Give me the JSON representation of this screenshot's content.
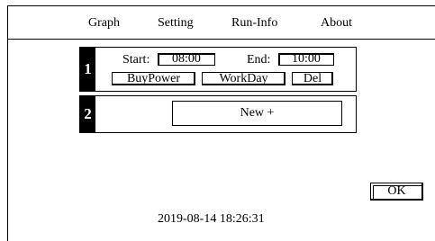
{
  "menu": {
    "graph": "Graph",
    "setting": "Setting",
    "run_info": "Run-Info",
    "about": "About"
  },
  "slots": [
    {
      "number": "1",
      "start_label": "Start:",
      "start_value": "08:00",
      "end_label": "End:",
      "end_value": "10:00",
      "mode_button": "BuyPower",
      "day_button": "WorkDay",
      "delete_button": "Del"
    },
    {
      "number": "2",
      "new_button": "New +"
    }
  ],
  "ok_button": "OK",
  "clock": "2019-08-14 18:26:31"
}
